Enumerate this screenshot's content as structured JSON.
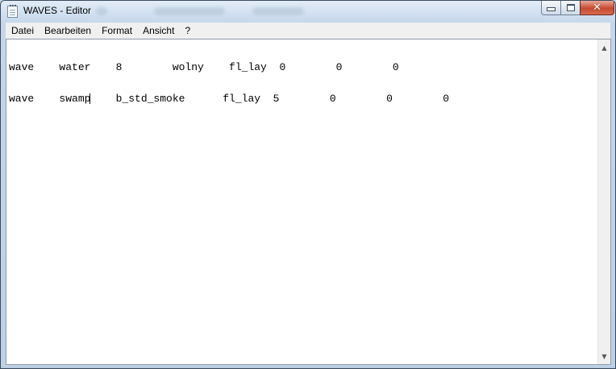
{
  "window": {
    "title": "WAVES - Editor"
  },
  "caption_buttons": {
    "minimize_icon": "minimize-icon",
    "maximize_icon": "maximize-icon",
    "close_glyph": "✕"
  },
  "menu": {
    "items": [
      "Datei",
      "Bearbeiten",
      "Format",
      "Ansicht",
      "?"
    ]
  },
  "editor": {
    "lines": [
      "wave    water    8        wolny    fl_lay  0        0        0",
      "wave    swamp    b_std_smoke      fl_lay  5        0        0        0"
    ],
    "caret_line": 1,
    "caret_after": "wave    swamp"
  },
  "scrollbar": {
    "up_arrow": "▲",
    "down_arrow": "▼"
  }
}
